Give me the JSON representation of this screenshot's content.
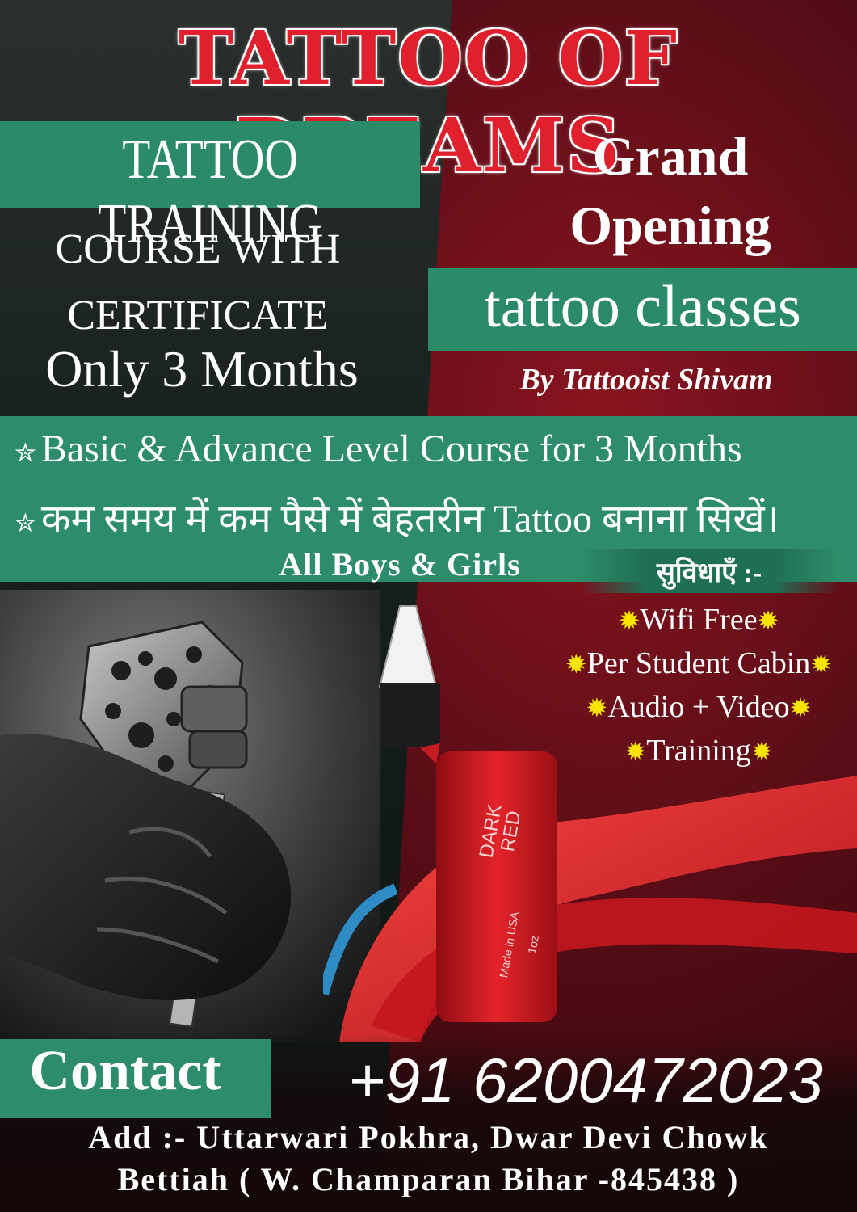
{
  "header": {
    "title": "TATTOO OF DREAMS"
  },
  "left_panel": {
    "training": "TATTOO TRAINING",
    "course_line1": "COURSE WITH",
    "course_line2": "CERTIFICATE",
    "duration": "Only 3 Months"
  },
  "right_panel": {
    "grand_line1": "Grand",
    "grand_line2": "Opening",
    "classes": "tattoo classes",
    "by": "By Tattooist Shivam"
  },
  "features": {
    "item1": "Basic & Advance Level Course for 3 Months",
    "item2": "कम समय में कम पैसे में बेहतरीन Tattoo बनाना सिखें।",
    "audience": "All Boys & Girls",
    "facilities_heading": "सुविधाएँ :-"
  },
  "facilities": [
    "Wifi Free",
    "Per Student Cabin",
    "Audio + Video",
    "Training"
  ],
  "bottle": {
    "label_line1": "DARK",
    "label_line2": "RED",
    "label_line3": "Made in USA",
    "label_line4": "1oz"
  },
  "contact": {
    "label": "Contact",
    "phone": "+91 6200472023",
    "address_line1": "Add :- Uttarwari Pokhra, Dwar Devi Chowk",
    "address_line2": "Bettiah ( W. Champaran Bihar -845438 )"
  },
  "colors": {
    "title_red": "#e0202c",
    "band_green": "#2d8c69",
    "star_yellow": "#f7e400"
  }
}
